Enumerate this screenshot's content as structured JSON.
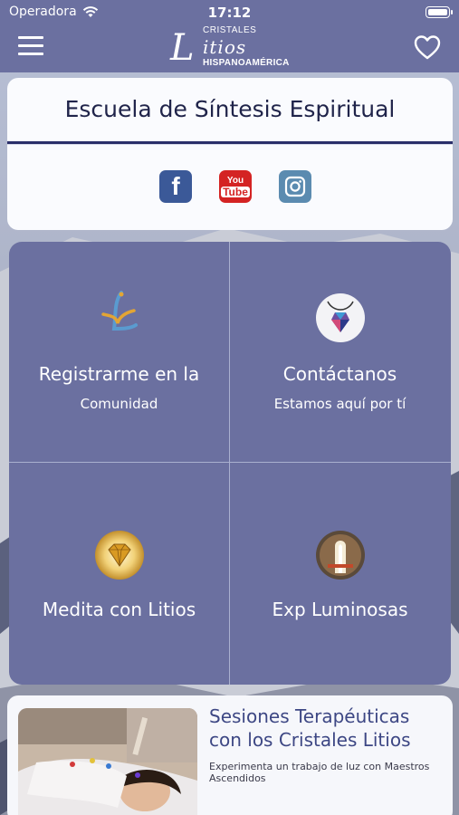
{
  "status_bar": {
    "carrier": "Operadora",
    "time": "17:12"
  },
  "app_bar": {
    "logo": {
      "line1": "CRISTALES",
      "initial": "L",
      "line2": "itios",
      "line3": "HISPANOAMÉRICA"
    }
  },
  "header": {
    "title": "Escuela de Síntesis Espiritual",
    "social": [
      {
        "name": "Facebook",
        "glyph": "f"
      },
      {
        "name": "YouTube",
        "glyph_top": "You",
        "glyph_bottom": "Tube"
      },
      {
        "name": "Instagram"
      }
    ]
  },
  "tiles": [
    {
      "label": "Registrarme en la",
      "sub": "Comunidad"
    },
    {
      "label": "Contáctanos",
      "sub": "Estamos aquí por tí"
    },
    {
      "label": "Medita con Litios",
      "sub": ""
    },
    {
      "label": "Exp Luminosas",
      "sub": ""
    }
  ],
  "feature": {
    "title": "Sesiones Terapéuticas con los Cristales Litios",
    "description": "Experimenta un trabajo de luz  con Maestros Ascendidos"
  },
  "colors": {
    "accent": "#6b70a0",
    "title_text": "#20244a",
    "feature_title": "#3d4784"
  }
}
